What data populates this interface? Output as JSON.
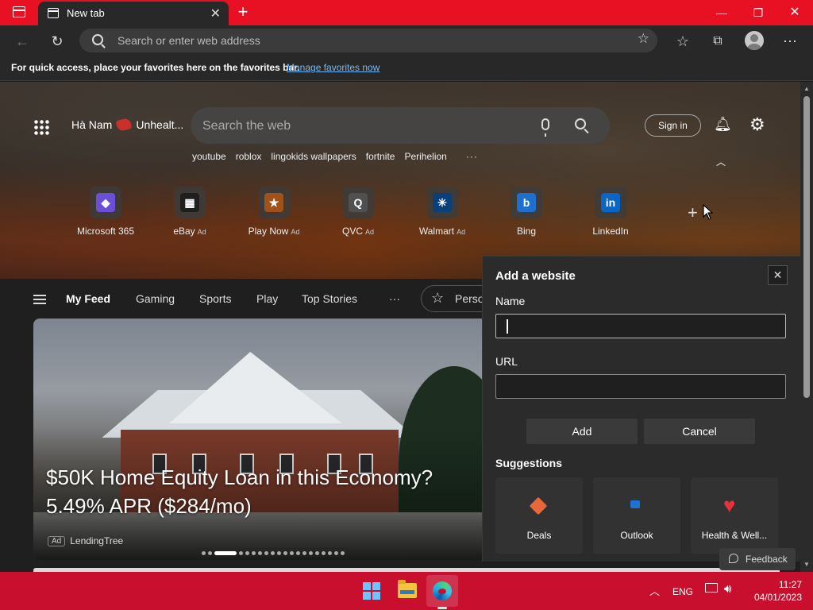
{
  "browser": {
    "tab_title": "New tab",
    "new_tab": "+",
    "address_placeholder": "Search or enter web address",
    "favorites_bar_text": "For quick access, place your favorites here on the favorites bar.",
    "favorites_bar_link": "Manage favorites now"
  },
  "ntp": {
    "location": "Hà Nam",
    "weather_text": "Unhealt...",
    "search_placeholder": "Search the web",
    "sign_in": "Sign in",
    "trending": [
      "youtube",
      "roblox",
      "lingokids wallpapers",
      "fortnite",
      "Perihelion"
    ],
    "trending_more": "···",
    "quick_links": [
      {
        "label": "Microsoft 365",
        "ad": "",
        "color": "#6b4fd8",
        "glyph": "◆"
      },
      {
        "label": "eBay",
        "ad": "Ad",
        "color": "#1f1f1f",
        "glyph": "▦"
      },
      {
        "label": "Play Now",
        "ad": "Ad",
        "color": "#a0521b",
        "glyph": "★"
      },
      {
        "label": "QVC",
        "ad": "Ad",
        "color": "#505050",
        "glyph": "Q"
      },
      {
        "label": "Walmart",
        "ad": "Ad",
        "color": "#0a3f7a",
        "glyph": "✳"
      },
      {
        "label": "Bing",
        "ad": "",
        "color": "#1f6fd1",
        "glyph": "b"
      },
      {
        "label": "LinkedIn",
        "ad": "",
        "color": "#0a66c2",
        "glyph": "in"
      }
    ]
  },
  "feed": {
    "tabs": [
      "My Feed",
      "Gaming",
      "Sports",
      "Play",
      "Top Stories"
    ],
    "more": "···",
    "personalize": "Perso",
    "card_title": "$50K Home Equity Loan in this Economy? 5.49% APR ($284/mo)",
    "card_ad_badge": "Ad",
    "card_source": "LendingTree"
  },
  "dialog": {
    "title": "Add a website",
    "name_label": "Name",
    "name_value": "",
    "url_label": "URL",
    "url_value": "",
    "add_button": "Add",
    "cancel_button": "Cancel",
    "suggestions_title": "Suggestions",
    "suggestions": [
      {
        "label": "Deals"
      },
      {
        "label": "Outlook"
      },
      {
        "label": "Health & Well..."
      }
    ]
  },
  "feedback_label": "Feedback",
  "taskbar": {
    "language": "ENG",
    "time": "11:27",
    "date": "04/01/2023"
  }
}
